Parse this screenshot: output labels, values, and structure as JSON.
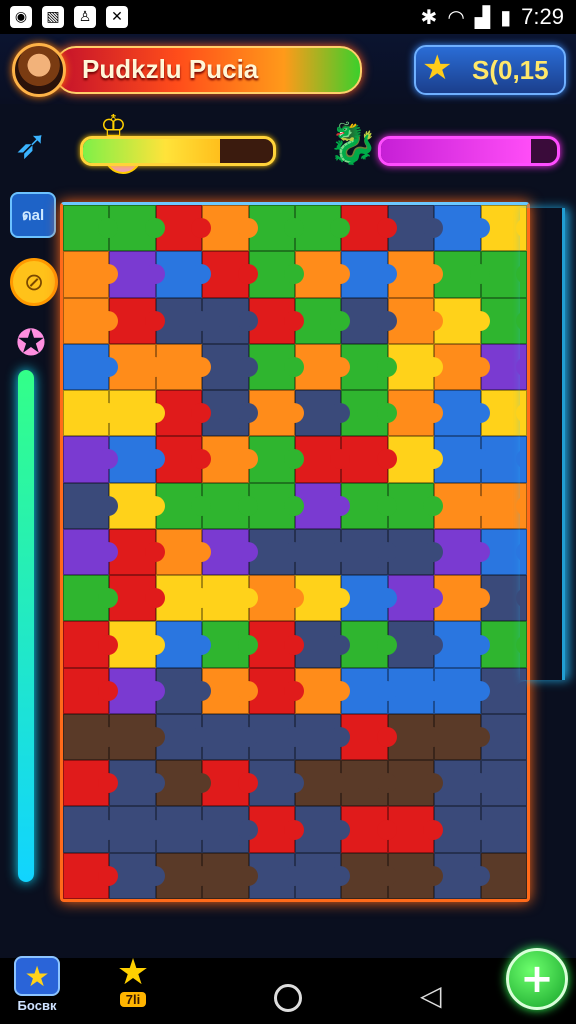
{
  "status_bar": {
    "time": "7:29",
    "left_icons": [
      "notification-icon",
      "image-icon",
      "app-icon",
      "shuffle-icon"
    ],
    "right_icons": [
      "bluetooth-icon",
      "wifi-icon",
      "signal-icon",
      "battery-icon"
    ]
  },
  "header": {
    "title": "Pudkzlu Pucia",
    "score": "S(0,15",
    "accent_color": "#ff4d1a"
  },
  "progress": {
    "player_bar_fraction": 0.72,
    "opponent_bar_fraction": 0.85
  },
  "side_buttons": {
    "badge_label": "ดаl"
  },
  "bottom_nav": {
    "button1_label": "Бocвк",
    "button2_label": "7li"
  },
  "board": {
    "palette": [
      "#e01b1b",
      "#ff8c1a",
      "#ffd21a",
      "#2fb52f",
      "#2a76e0",
      "#7a3ad1",
      "#3a4a7a",
      "#5a3a28",
      "#9aa0b0"
    ]
  }
}
